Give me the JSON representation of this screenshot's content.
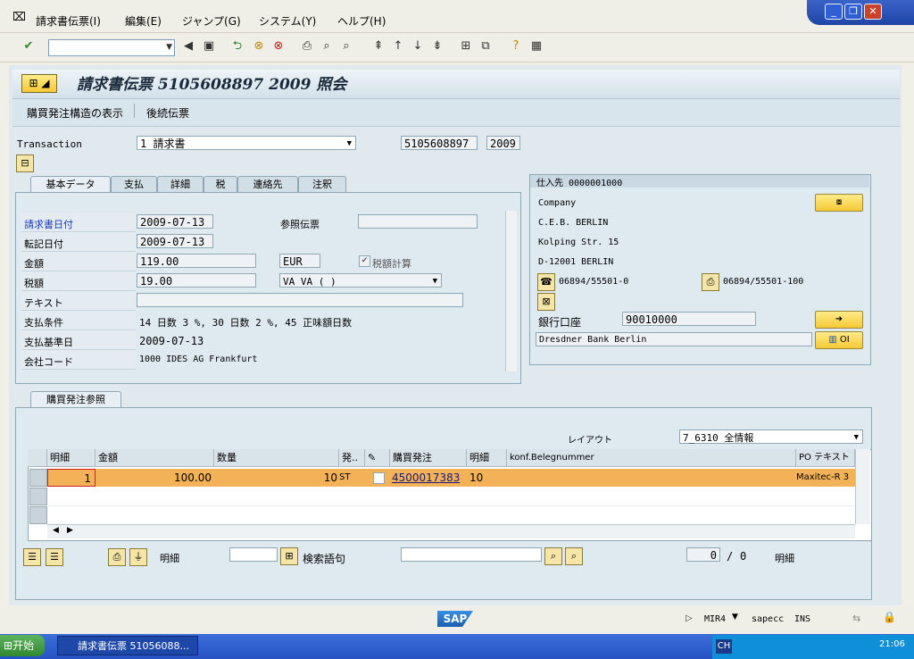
{
  "menu": [
    "請求書伝票(I)",
    "編集(E)",
    "ジャンプ(G)",
    "システム(Y)",
    "ヘルプ(H)"
  ],
  "title": "請求書伝票 5105608897 2009 照会",
  "appbar": [
    "購買発注構造の表示",
    "後続伝票"
  ],
  "transaction": {
    "label": "Transaction",
    "value": "1 請求書",
    "doc_no": "5105608897",
    "year": "2009"
  },
  "tabs": [
    "基本データ",
    "支払",
    "詳細",
    "税",
    "連絡先",
    "注釈"
  ],
  "basic": {
    "invoice_date_label": "請求書日付",
    "invoice_date": "2009-07-13",
    "ref_label": "参照伝票",
    "ref_value": "",
    "posting_date_label": "転記日付",
    "posting_date": "2009-07-13",
    "amount_label": "金額",
    "amount": "119.00",
    "currency": "EUR",
    "calc_tax_label": "税額計算",
    "tax_label": "税額",
    "tax": "19.00",
    "tax_code": "VA VA ( )",
    "text_label": "テキスト",
    "text": "",
    "terms_label": "支払条件",
    "terms": "14 日数 3 %, 30 日数 2 %, 45 正味額日数",
    "baseline_label": "支払基準日",
    "baseline": "2009-07-13",
    "company_label": "会社コード",
    "company": "1000 IDES AG Frankfurt"
  },
  "vendor": {
    "header": "仕入先 0000001000",
    "lines": [
      "Company",
      "C.E.B. BERLIN",
      "Kolping Str. 15",
      "D-12001 BERLIN"
    ],
    "phone": "06894/55501-0",
    "fax": "06894/55501-100",
    "bank_label": "銀行口座",
    "bank_account": "90010000",
    "bank_name": "Dresdner Bank Berlin",
    "oi": "OI"
  },
  "po_tab": "購買発注参照",
  "layout": {
    "label": "レイアウト",
    "value": "7_6310 全情報"
  },
  "grid": {
    "headers": [
      "明細",
      "金額",
      "数量",
      "発..",
      "",
      "購買発注",
      "明細",
      "konf.Belegnummer",
      "PO テキスト"
    ],
    "row": {
      "item": "1",
      "amount": "100.00",
      "qty": "10",
      "unit": "ST",
      "po": "4500017383",
      "po_item": "10",
      "conf": "",
      "text": "Maxitec-R 3"
    }
  },
  "bottom": {
    "item_label": "明細",
    "search_label": "検索語句",
    "count": "0",
    "of": "/",
    "total": "0",
    "item_label2": "明細"
  },
  "status": {
    "tcode": "MIR4",
    "system": "sapecc",
    "mode": "INS"
  },
  "taskbar": {
    "start": "开始",
    "task": "請求書伝票 51056088...",
    "lang": "CH",
    "clock": "21:06"
  }
}
